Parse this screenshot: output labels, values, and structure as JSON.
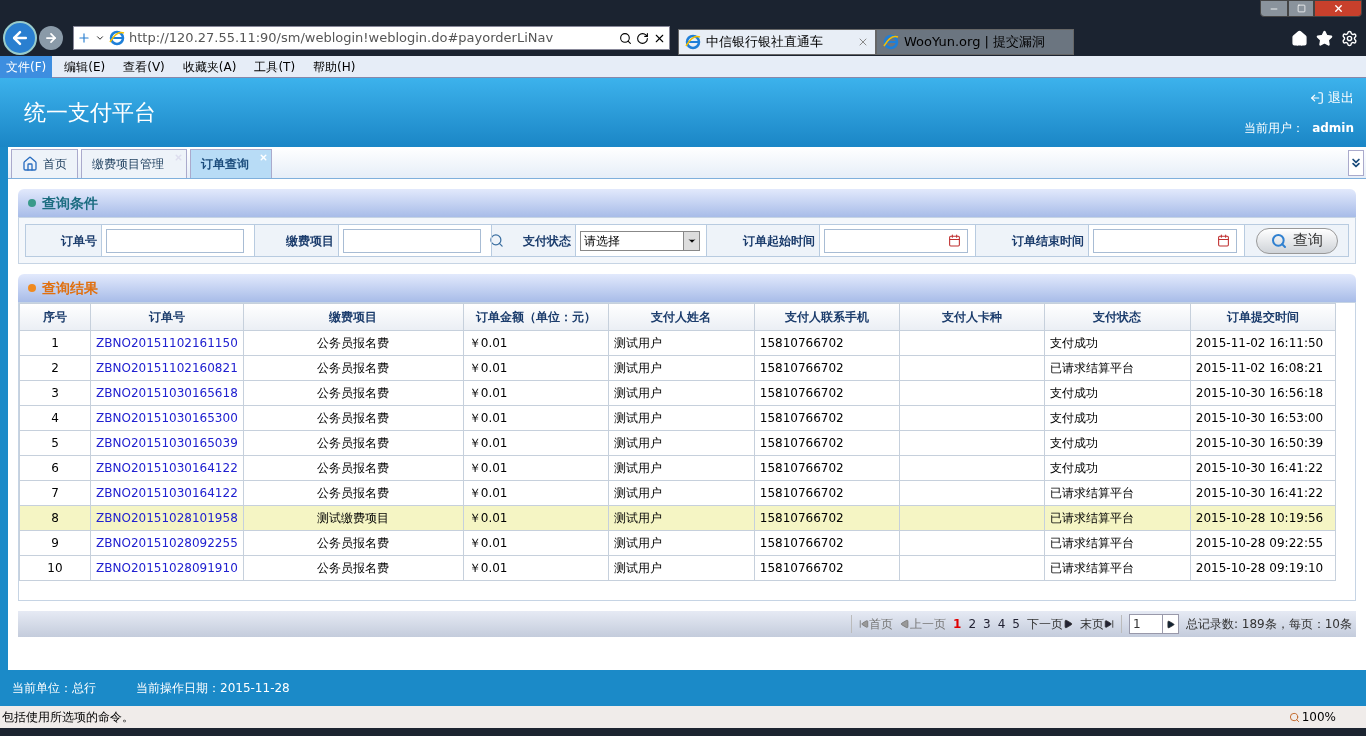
{
  "browser": {
    "address": "http://120.27.55.11:90/sm/weblogin!weblogin.do#payorderLiNav",
    "tabs": [
      {
        "title": "中信银行银社直通车",
        "selected": true
      },
      {
        "title": "WooYun.org | 提交漏洞",
        "selected": false
      }
    ],
    "menu": [
      {
        "label": "文件(F)",
        "selected": true
      },
      {
        "label": "编辑(E)",
        "selected": false
      },
      {
        "label": "查看(V)",
        "selected": false
      },
      {
        "label": "收藏夹(A)",
        "selected": false
      },
      {
        "label": "工具(T)",
        "selected": false
      },
      {
        "label": "帮助(H)",
        "selected": false
      }
    ],
    "status_text": "包括使用所选项的命令。",
    "zoom": "100%"
  },
  "header": {
    "title": "统一支付平台",
    "logout": "退出",
    "user_label": "当前用户：",
    "user": "admin"
  },
  "page_tabs": [
    {
      "label": "首页",
      "kind": "home",
      "selected": false
    },
    {
      "label": "缴费项目管理",
      "kind": "closable",
      "selected": false
    },
    {
      "label": "订单查询",
      "kind": "closable",
      "selected": true
    }
  ],
  "query": {
    "title": "查询条件",
    "fields": [
      {
        "label": "订单号",
        "kind": "text"
      },
      {
        "label": "缴费项目",
        "kind": "lookup"
      },
      {
        "label": "支付状态",
        "kind": "select",
        "value": "请选择"
      },
      {
        "label": "订单起始时间",
        "kind": "date"
      },
      {
        "label": "订单结束时间",
        "kind": "date"
      }
    ],
    "button": "查询"
  },
  "results": {
    "title": "查询结果",
    "columns": [
      "序号",
      "订单号",
      "缴费项目",
      "订单金额（单位：元）",
      "支付人姓名",
      "支付人联系手机",
      "支付人卡种",
      "支付状态",
      "订单提交时间"
    ],
    "rows": [
      {
        "selected": false,
        "cells": [
          "1",
          "ZBNO20151102161150",
          "公务员报名费",
          "￥0.01",
          "测试用户",
          "15810766702",
          "",
          "支付成功",
          "2015-11-02 16:11:50"
        ]
      },
      {
        "selected": false,
        "cells": [
          "2",
          "ZBNO20151102160821",
          "公务员报名费",
          "￥0.01",
          "测试用户",
          "15810766702",
          "",
          "已请求结算平台",
          "2015-11-02 16:08:21"
        ]
      },
      {
        "selected": false,
        "cells": [
          "3",
          "ZBNO20151030165618",
          "公务员报名费",
          "￥0.01",
          "测试用户",
          "15810766702",
          "",
          "支付成功",
          "2015-10-30 16:56:18"
        ]
      },
      {
        "selected": false,
        "cells": [
          "4",
          "ZBNO20151030165300",
          "公务员报名费",
          "￥0.01",
          "测试用户",
          "15810766702",
          "",
          "支付成功",
          "2015-10-30 16:53:00"
        ]
      },
      {
        "selected": false,
        "cells": [
          "5",
          "ZBNO20151030165039",
          "公务员报名费",
          "￥0.01",
          "测试用户",
          "15810766702",
          "",
          "支付成功",
          "2015-10-30 16:50:39"
        ]
      },
      {
        "selected": false,
        "cells": [
          "6",
          "ZBNO20151030164122",
          "公务员报名费",
          "￥0.01",
          "测试用户",
          "15810766702",
          "",
          "支付成功",
          "2015-10-30 16:41:22"
        ]
      },
      {
        "selected": false,
        "cells": [
          "7",
          "ZBNO20151030164122",
          "公务员报名费",
          "￥0.01",
          "测试用户",
          "15810766702",
          "",
          "已请求结算平台",
          "2015-10-30 16:41:22"
        ]
      },
      {
        "selected": true,
        "cells": [
          "8",
          "ZBNO20151028101958",
          "测试缴费项目",
          "￥0.01",
          "测试用户",
          "15810766702",
          "",
          "已请求结算平台",
          "2015-10-28 10:19:56"
        ]
      },
      {
        "selected": false,
        "cells": [
          "9",
          "ZBNO20151028092255",
          "公务员报名费",
          "￥0.01",
          "测试用户",
          "15810766702",
          "",
          "已请求结算平台",
          "2015-10-28 09:22:55"
        ]
      },
      {
        "selected": false,
        "cells": [
          "10",
          "ZBNO20151028091910",
          "公务员报名费",
          "￥0.01",
          "测试用户",
          "15810766702",
          "",
          "已请求结算平台",
          "2015-10-28 09:19:10"
        ]
      }
    ]
  },
  "pager": {
    "first": "首页",
    "prev": "上一页",
    "pages": [
      {
        "label": "1",
        "selected": true
      },
      {
        "label": "2",
        "selected": false
      },
      {
        "label": "3",
        "selected": false
      },
      {
        "label": "4",
        "selected": false
      },
      {
        "label": "5",
        "selected": false
      }
    ],
    "next": "下一页",
    "last": "末页",
    "page_input": "1",
    "summary": "总记录数: 189条，每页：10条"
  },
  "footer": {
    "unit": "当前单位：总行",
    "date": "当前操作日期：2015-11-28"
  }
}
